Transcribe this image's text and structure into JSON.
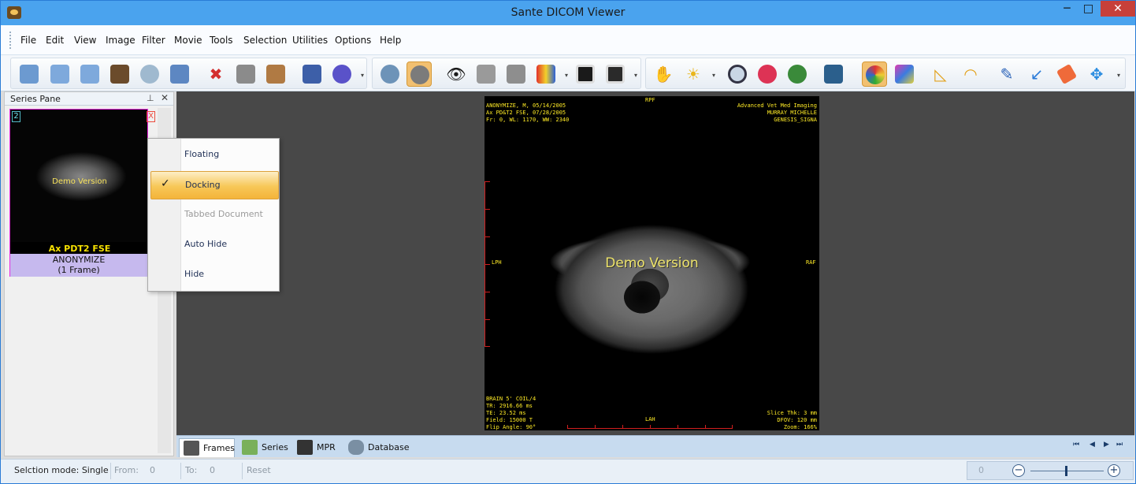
{
  "window": {
    "title": "Sante DICOM Viewer",
    "min": "─",
    "max": "□",
    "close": "✕"
  },
  "menu": [
    "File",
    "Edit",
    "View",
    "Image",
    "Filter",
    "Movie",
    "Tools",
    "Selection",
    "Utilities",
    "Options",
    "Help"
  ],
  "toolbar": {
    "icons": [
      "folder-stack-icon",
      "folder-icon",
      "folder-open-icon",
      "scanner-icon",
      "cd-icon",
      "network-icon",
      "delete-file-icon",
      "print-icon",
      "clipboard-icon",
      "report-icon",
      "info-icon",
      "sync-icon",
      "link-icon",
      "eye-icon",
      "xray-icon",
      "lungs-icon",
      "color-palette-icon",
      "window-level-icon",
      "window-fit-icon",
      "hand-pan-icon",
      "brightness-icon",
      "magnifier-icon",
      "zoom-area-icon",
      "zoom-region-icon",
      "annotate-pen-icon",
      "color-map-icon",
      "rgb-icon",
      "ruler-triangle-icon",
      "protractor-icon",
      "pencil-icon",
      "arrow-icon",
      "eraser-icon",
      "move-icon"
    ],
    "active": [
      "link-icon",
      "color-map-icon"
    ]
  },
  "series_pane": {
    "title": "Series Pane",
    "pin": "⊥",
    "close": "✕",
    "thumbnail": {
      "number": "2",
      "close": "X",
      "watermark": "Demo Version",
      "series_name": "Ax PDT2 FSE",
      "patient": "ANONYMIZE",
      "frames": "(1 Frame)"
    }
  },
  "context_menu": {
    "items": [
      {
        "label": "Floating",
        "state": "normal",
        "check": ""
      },
      {
        "label": "Docking",
        "state": "selected",
        "check": "✓"
      },
      {
        "label": "Tabbed Document",
        "state": "disabled",
        "check": ""
      },
      {
        "label": "Auto Hide",
        "state": "normal",
        "check": ""
      },
      {
        "label": "Hide",
        "state": "normal",
        "check": ""
      }
    ]
  },
  "image": {
    "top_left": [
      "ANONYMIZE, M, 05/14/2005",
      "Ax PD&T2 FSE,  07/28/2005",
      "Fr: 0,  WL: 1170,  WW: 2340"
    ],
    "top_center": "RPF",
    "top_right": [
      "Advanced Vet Med Imaging",
      "MURRAY MICHELLE",
      "GENESIS_SIGNA"
    ],
    "left_center": "LPH",
    "right_center": "RAF",
    "watermark": "Demo Version",
    "bottom_left": [
      "BRAIN 5' COIL/4",
      "TR: 2916.66 ms",
      "TE: 23.52 ms",
      "Field: 15000 T",
      "Flip Angle: 90°"
    ],
    "bottom_center": "LAH",
    "bottom_right": [
      "Slice Thk: 3 mm",
      "DFOV: 120 mm",
      "Zoom: 166%"
    ]
  },
  "tabs": [
    {
      "label": "Frames",
      "icon": "frames-icon",
      "active": true
    },
    {
      "label": "Series",
      "icon": "series-icon",
      "active": false
    },
    {
      "label": "MPR",
      "icon": "mpr-icon",
      "active": false
    },
    {
      "label": "Database",
      "icon": "database-icon",
      "active": false
    }
  ],
  "nav": {
    "first": "⏮",
    "prev": "◀",
    "next": "▶",
    "last": "⏭"
  },
  "status": {
    "mode": "Selction mode: Single",
    "from_label": "From:",
    "from_value": "0",
    "to_label": "To:",
    "to_value": "0",
    "reset": "Reset",
    "zoom_value": "0",
    "zoom_minus": "−",
    "zoom_plus": "+"
  },
  "colors": {
    "titlebar": "#4aa3ee",
    "menu_selected": "#f7c757",
    "overlay_text": "#ffeb26",
    "thumb_border": "#ea29e0"
  }
}
